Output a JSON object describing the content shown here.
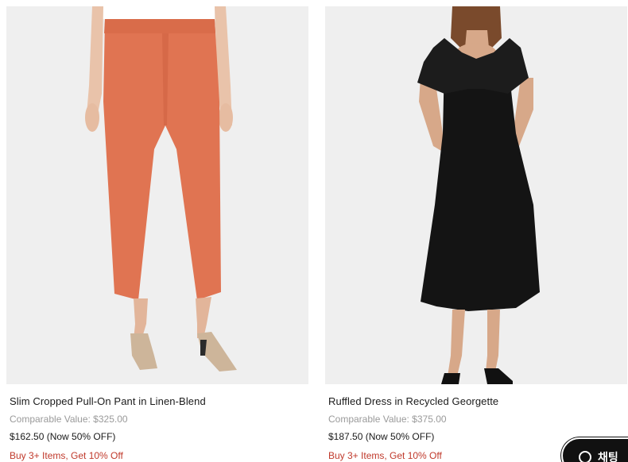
{
  "products": [
    {
      "title": "Slim Cropped Pull-On Pant in Linen-Blend",
      "comparable": "Comparable Value: $325.00",
      "price": "$162.50 (Now 50% OFF)",
      "promo": "Buy 3+ Items, Get 10% Off",
      "image_bg": "#efefef",
      "garment_color": "#e07452"
    },
    {
      "title": "Ruffled Dress in Recycled Georgette",
      "comparable": "Comparable Value: $375.00",
      "price": "$187.50 (Now 50% OFF)",
      "promo": "Buy 3+ Items, Get 10% Off",
      "image_bg": "#efefef",
      "garment_color": "#141414"
    }
  ],
  "chat": {
    "label": "채팅",
    "icon": "chat-search-icon"
  },
  "colors": {
    "promo": "#c0392b",
    "muted": "#9a9a9a",
    "text": "#1a1a1a"
  }
}
